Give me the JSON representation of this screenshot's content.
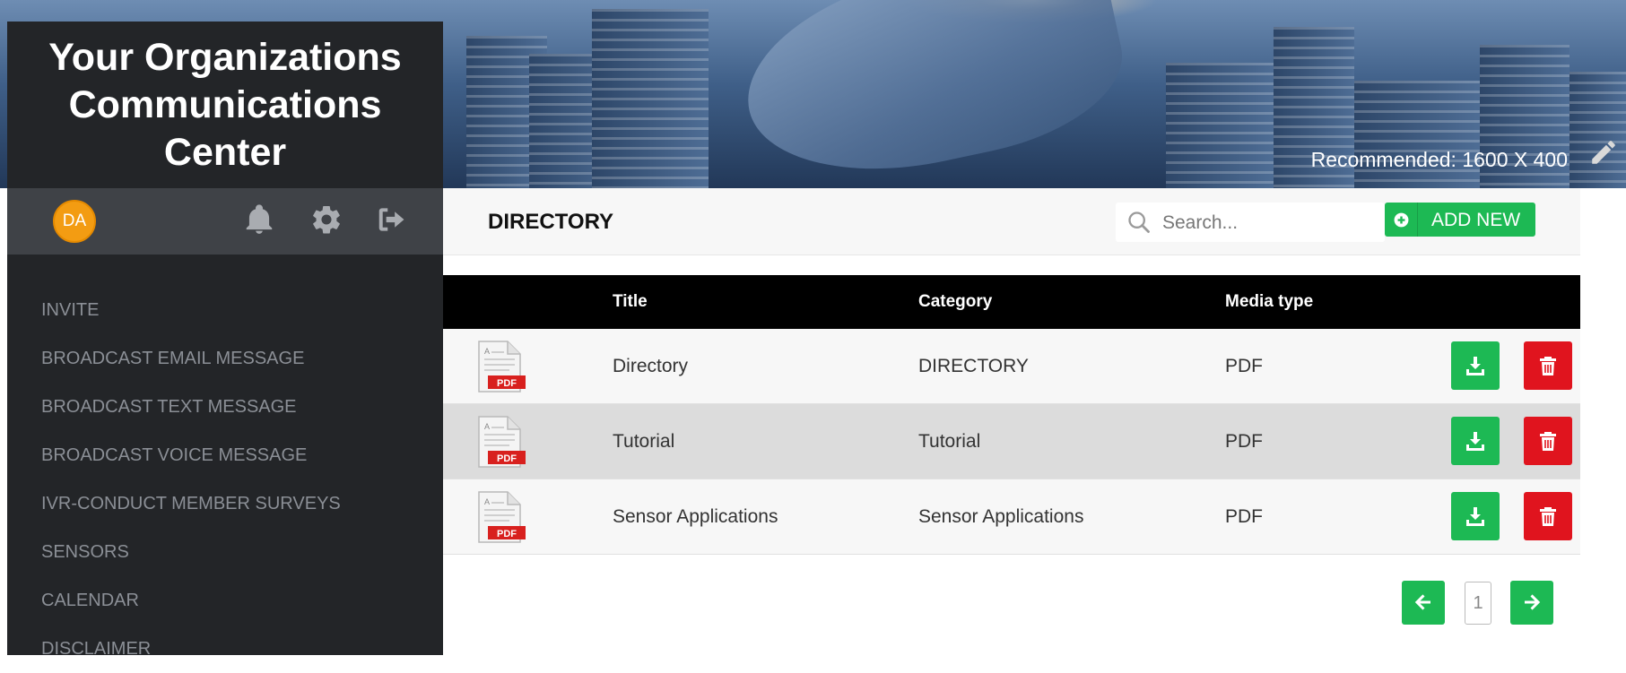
{
  "banner": {
    "recommended_text": "Recommended: 1600 X 400",
    "edit_icon": "pencil-icon"
  },
  "sidebar": {
    "brand_lines": [
      "Your Organizations",
      "Communications",
      "Center"
    ],
    "avatar_initials": "DA",
    "avatar_color": "#f39c12",
    "icons": [
      "bell-icon",
      "gear-icon",
      "logout-icon"
    ],
    "nav_items": [
      "INVITE",
      "BROADCAST EMAIL MESSAGE",
      "BROADCAST TEXT MESSAGE",
      "BROADCAST VOICE MESSAGE",
      "IVR-CONDUCT MEMBER SURVEYS",
      "SENSORS",
      "CALENDAR",
      "DISCLAIMER"
    ]
  },
  "header": {
    "title": "DIRECTORY",
    "search_placeholder": "Search...",
    "add_new_label": "ADD NEW"
  },
  "table": {
    "columns": [
      "Title",
      "Category",
      "Media type"
    ],
    "rows": [
      {
        "title": "Directory",
        "category": "DIRECTORY",
        "media_type": "PDF"
      },
      {
        "title": "Tutorial",
        "category": "Tutorial",
        "media_type": "PDF"
      },
      {
        "title": "Sensor Applications",
        "category": "Sensor Applications",
        "media_type": "PDF"
      }
    ],
    "file_icon_label": "PDF"
  },
  "pagination": {
    "current_page": "1"
  },
  "colors": {
    "accent_green": "#1db954",
    "danger_red": "#e0141e",
    "sidebar_bg": "#232528"
  }
}
